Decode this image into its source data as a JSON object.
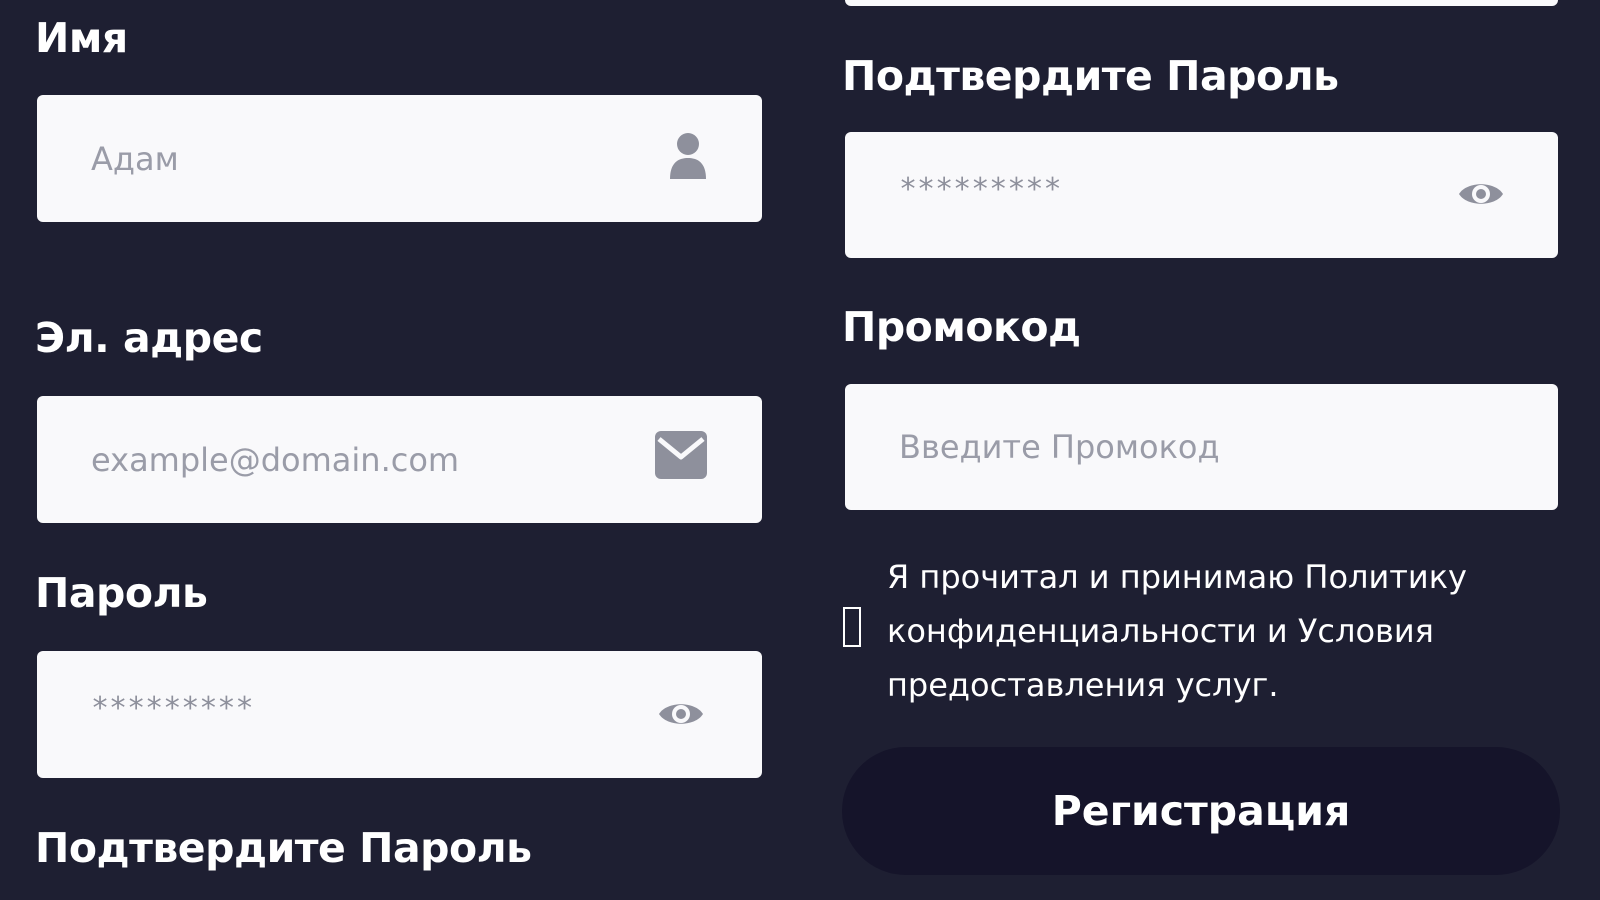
{
  "form": {
    "name": {
      "label": "Имя",
      "placeholder": "Адам",
      "icon": "user-icon"
    },
    "email": {
      "label": "Эл. адрес",
      "placeholder": "example@domain.com",
      "icon": "envelope-icon"
    },
    "password": {
      "label": "Пароль",
      "value": "*********",
      "icon": "eye-icon"
    },
    "confirm_password_left": {
      "label": "Подтвердите Пароль"
    },
    "confirm_password": {
      "label": "Подтвердите Пароль",
      "value": "*********",
      "icon": "eye-icon"
    },
    "promo": {
      "label": "Промокод",
      "placeholder": "Введите Промокод"
    },
    "terms": {
      "text": "Я прочитал и принимаю Политику конфиденциальности и Условия предоставления услуг.",
      "checked": false
    },
    "submit_label": "Регистрация"
  },
  "colors": {
    "background": "#1e1f32",
    "field": "#f9f9fb",
    "icon": "#8e909c",
    "button": "#15142a",
    "text": "#ffffff"
  }
}
